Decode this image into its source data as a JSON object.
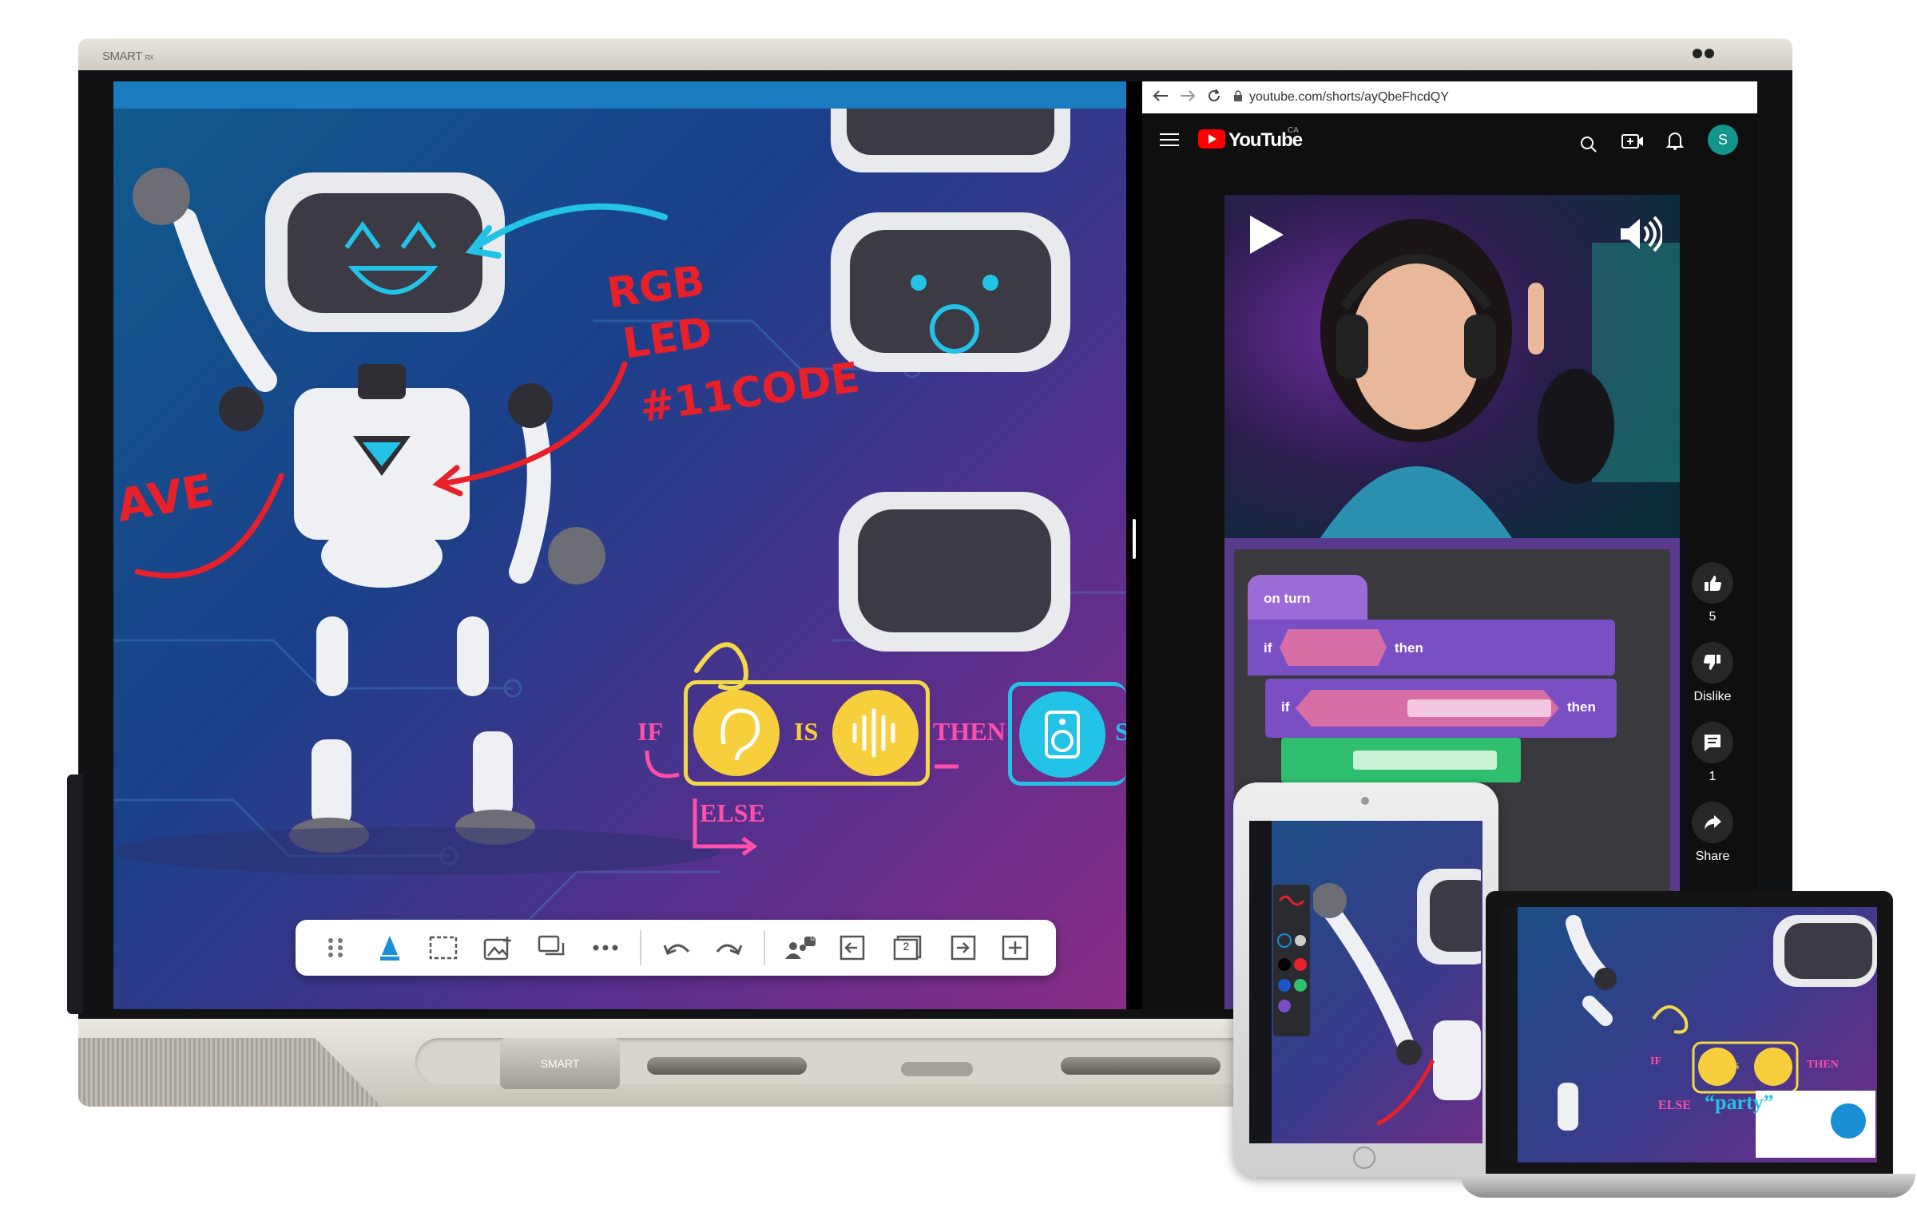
{
  "device": {
    "brand_label": "SMART",
    "brand_sub": "RX",
    "eraser_label": "SMART"
  },
  "canvas": {
    "annotations": {
      "rgb": "RGB",
      "led": "LED",
      "hashtag": "#11CODE",
      "wave": "AVE"
    },
    "logic": {
      "if": "IF",
      "is": "IS",
      "then": "THEN",
      "else": "ELSE",
      "trailing": "S"
    },
    "toolbar": {
      "items": [
        "drag-handle-icon",
        "pen-icon",
        "select-icon",
        "add-image-icon",
        "comments-icon",
        "more-icon",
        "undo-icon",
        "redo-icon",
        "participants-icon",
        "previous-page-icon",
        "page-number",
        "next-page-icon",
        "add-page-icon"
      ],
      "participants_count": "0",
      "page_number": "2"
    }
  },
  "browser": {
    "url": "youtube.com/shorts/ayQbeFhcdQY",
    "youtube_label": "YouTube",
    "region": "CA",
    "avatar_letter": "S",
    "actions": {
      "likes": "5",
      "dislike_label": "Dislike",
      "comments": "1",
      "share_label": "Share"
    },
    "blocks": {
      "on_turn": "on turn",
      "if1": "if",
      "then1": "then",
      "if2": "if",
      "then2": "then"
    }
  },
  "laptop": {
    "if": "IF",
    "is": "IS",
    "then": "THEN",
    "else": "ELSE",
    "party": "“party”"
  }
}
